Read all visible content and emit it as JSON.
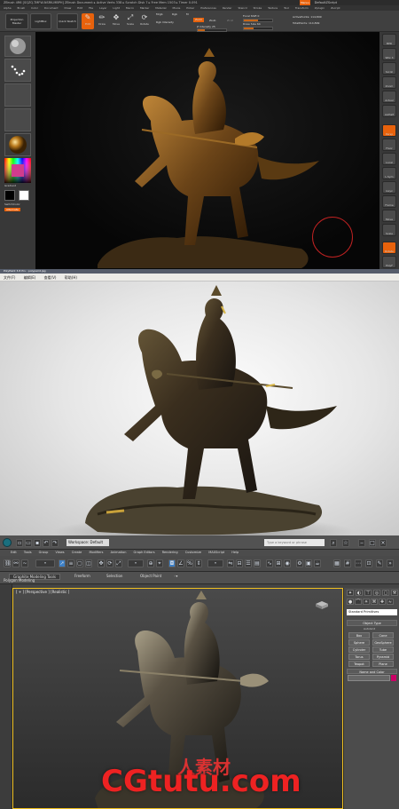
{
  "zbrush": {
    "title": "ZBrush 4R6 [SQZQ-TMFW-NSRK-MBPH]   ZBrush Document  ▸ Active Verts 338  ▸ Scratch Disk 7  ▸ Free Mem 1503  ▸ Timer 0.091",
    "default_button": "Menus",
    "default_script": "DefaultZScript",
    "menus": [
      "Alpha",
      "Brush",
      "Color",
      "Document",
      "Draw",
      "Edit",
      "File",
      "Layer",
      "Light",
      "Macro",
      "Marker",
      "Material",
      "Movie",
      "Picker",
      "Preferences",
      "Render",
      "Stencil",
      "Stroke",
      "Texture",
      "Tool",
      "Transform",
      "Zplugin",
      "Zscript"
    ],
    "shelf": {
      "projection_master": "Projection Master",
      "lightbox": "LightBox",
      "quick_sketch": "Quick Sketch",
      "edit": "Edit",
      "draw": "Draw",
      "move": "Move",
      "scale": "Scale",
      "rotate": "Rotate",
      "mrgb": "Mrgb",
      "rgb": "Rgb",
      "m": "M",
      "rgb_intensity": "Rgb Intensity",
      "zadd": "Zadd",
      "zsub": "Zsub",
      "zcut": "Zcut",
      "z_intensity": "Z Intensity 25",
      "focal_shift": "Focal Shift 0",
      "draw_size": "Draw Size 64",
      "active_points": "ActivePoints: 114,899",
      "total_points": "TotalPoints: 114,899"
    },
    "left_labels": {
      "gradient": "Gradient",
      "switch_color": "SwitchColor",
      "alternate": "Alternate"
    },
    "right_labels": [
      "BPR",
      "SPix 3",
      "Scroll",
      "Zoom",
      "Actual",
      "AAHalf",
      "Persp",
      "Floor",
      "Local",
      "L.Sym",
      "Gxyz",
      "Frame",
      "Move",
      "Scale",
      "Rotate",
      "PolyF",
      "Transp",
      "Solo",
      "Xpose"
    ],
    "status": "PolyPaint 3.8 Prv  :  polypaint.jpg"
  },
  "render": {
    "menubar": [
      "文件(F)",
      "编辑(E)",
      "查看(V)",
      "帮助(H)"
    ]
  },
  "max": {
    "workspace": "Workspace: Default",
    "search_placeholder": "Type a keyword or phrase",
    "menus": [
      "Edit",
      "Tools",
      "Group",
      "Views",
      "Create",
      "Modifiers",
      "Animation",
      "Graph Editors",
      "Rendering",
      "Customize",
      "MAXScript",
      "Help"
    ],
    "ribbon_tabs": [
      "Graphite Modeling Tools",
      "Freeform",
      "Selection",
      "Object Paint"
    ],
    "polygon_modeling": "Polygon Modeling",
    "viewport_label": "[ + ] [Perspective ] [Realistic ]",
    "panel": {
      "dropdown": "Standard Primitives",
      "object_type": "Object Type",
      "autogrid": "AutoGrid",
      "objects": [
        "Box",
        "Cone",
        "Sphere",
        "GeoSphere",
        "Cylinder",
        "Tube",
        "Torus",
        "Pyramid",
        "Teapot",
        "Plane"
      ],
      "name_and_color": "Name and Color"
    }
  },
  "watermark": {
    "text": "CGtutu.com",
    "cn": "人素材"
  },
  "colors": {
    "zbrush_orange": "#e8620c",
    "max_viewport_border": "#f0c020",
    "watermark_red": "#ee2222"
  }
}
